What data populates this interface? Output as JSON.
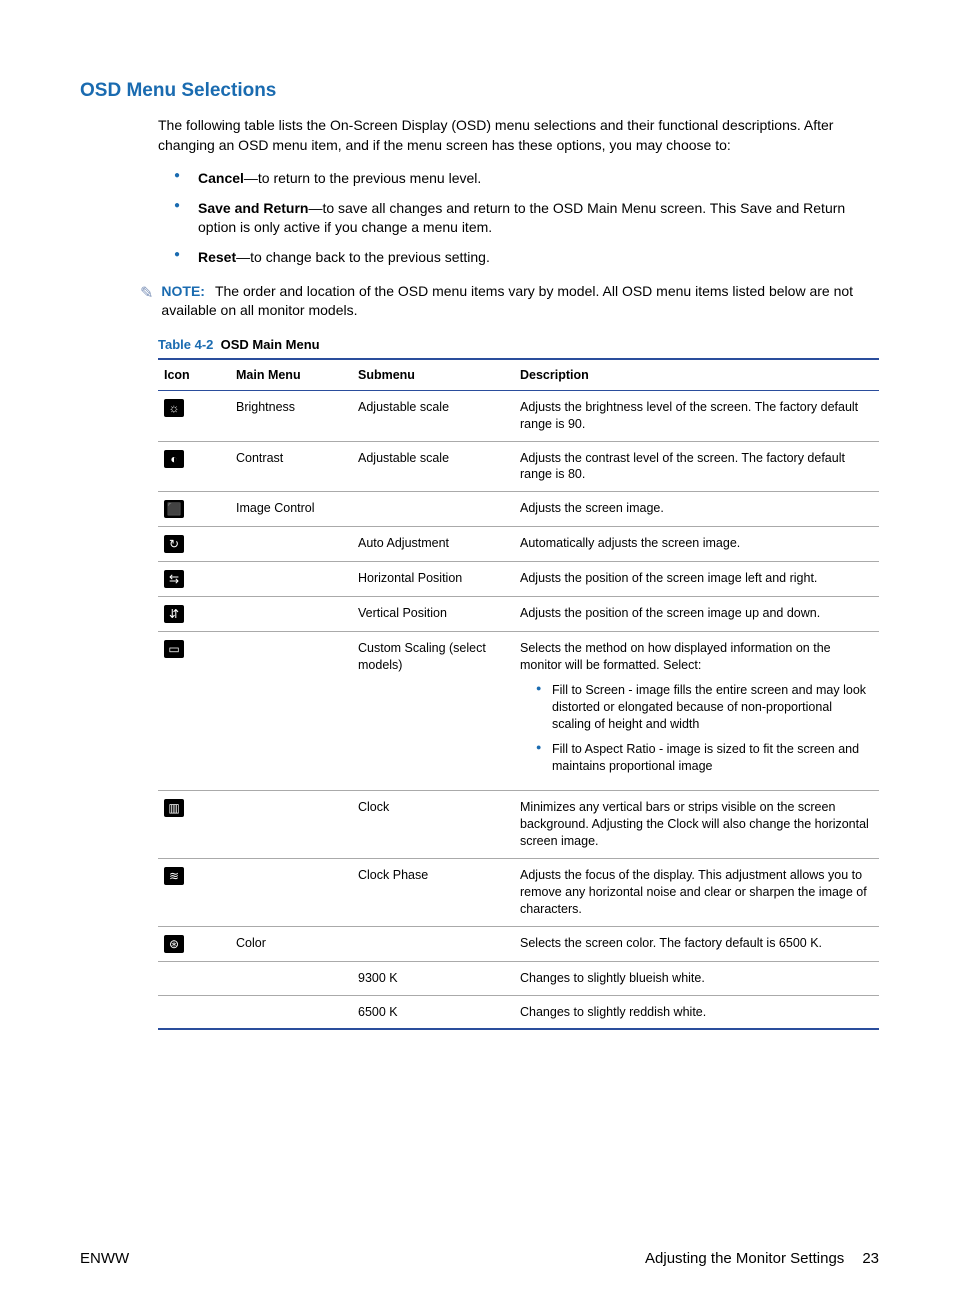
{
  "section_title": "OSD Menu Selections",
  "intro": "The following table lists the On-Screen Display (OSD) menu selections and their functional descriptions. After changing an OSD menu item, and if the menu screen has these options, you may choose to:",
  "bullets": [
    {
      "bold": "Cancel",
      "rest": "—to return to the previous menu level."
    },
    {
      "bold": "Save and Return",
      "rest": "—to save all changes and return to the OSD Main Menu screen. This Save and Return option is only active if you change a menu item."
    },
    {
      "bold": "Reset",
      "rest": "—to change back to the previous setting."
    }
  ],
  "note": {
    "label": "NOTE:",
    "text": "The order and location of the OSD menu items vary by model. All OSD menu items listed below are not available on all monitor models."
  },
  "table_caption_prefix": "Table 4-2",
  "table_caption_title": "OSD Main Menu",
  "headers": {
    "icon": "Icon",
    "main": "Main Menu",
    "sub": "Submenu",
    "desc": "Description"
  },
  "rows": [
    {
      "icon": "☼",
      "main": "Brightness",
      "sub": "Adjustable scale",
      "desc": "Adjusts the brightness level of the screen. The factory default range is 90."
    },
    {
      "icon": "◐",
      "main": "Contrast",
      "sub": "Adjustable scale",
      "desc": "Adjusts the contrast level of the screen. The factory default range is 80."
    },
    {
      "icon": "⬛",
      "main": "Image Control",
      "sub": "",
      "desc": "Adjusts the screen image."
    },
    {
      "icon": "↻",
      "main": "",
      "sub": "Auto Adjustment",
      "desc": "Automatically adjusts the screen image."
    },
    {
      "icon": "⇆",
      "main": "",
      "sub": "Horizontal Position",
      "desc": "Adjusts the position of the screen image left and right."
    },
    {
      "icon": "⇵",
      "main": "",
      "sub": "Vertical Position",
      "desc": "Adjusts the position of the screen image up and down."
    },
    {
      "icon": "▭",
      "main": "",
      "sub": "Custom Scaling (select models)",
      "desc_intro": "Selects the method on how displayed information on the monitor will be formatted. Select:",
      "sub_bullets": [
        "Fill to Screen - image fills the entire screen and may look distorted or elongated because of non-proportional scaling of height and width",
        "Fill to Aspect Ratio - image is sized to fit the screen and maintains proportional image"
      ]
    },
    {
      "icon": "▥",
      "main": "",
      "sub": "Clock",
      "desc": "Minimizes any vertical bars or strips visible on the screen background. Adjusting the Clock will also change the horizontal screen image."
    },
    {
      "icon": "≋",
      "main": "",
      "sub": "Clock Phase",
      "desc": "Adjusts the focus of the display. This adjustment allows you to remove any horizontal noise and clear or sharpen the image of characters."
    },
    {
      "icon": "⊛",
      "main": "Color",
      "sub": "",
      "desc": "Selects the screen color. The factory default is 6500 K."
    },
    {
      "icon": "",
      "main": "",
      "sub": "9300 K",
      "desc": "Changes to slightly blueish white."
    },
    {
      "icon": "",
      "main": "",
      "sub": "6500 K",
      "desc": "Changes to slightly reddish white."
    }
  ],
  "footer": {
    "left": "ENWW",
    "right_label": "Adjusting the Monitor Settings",
    "page": "23"
  }
}
